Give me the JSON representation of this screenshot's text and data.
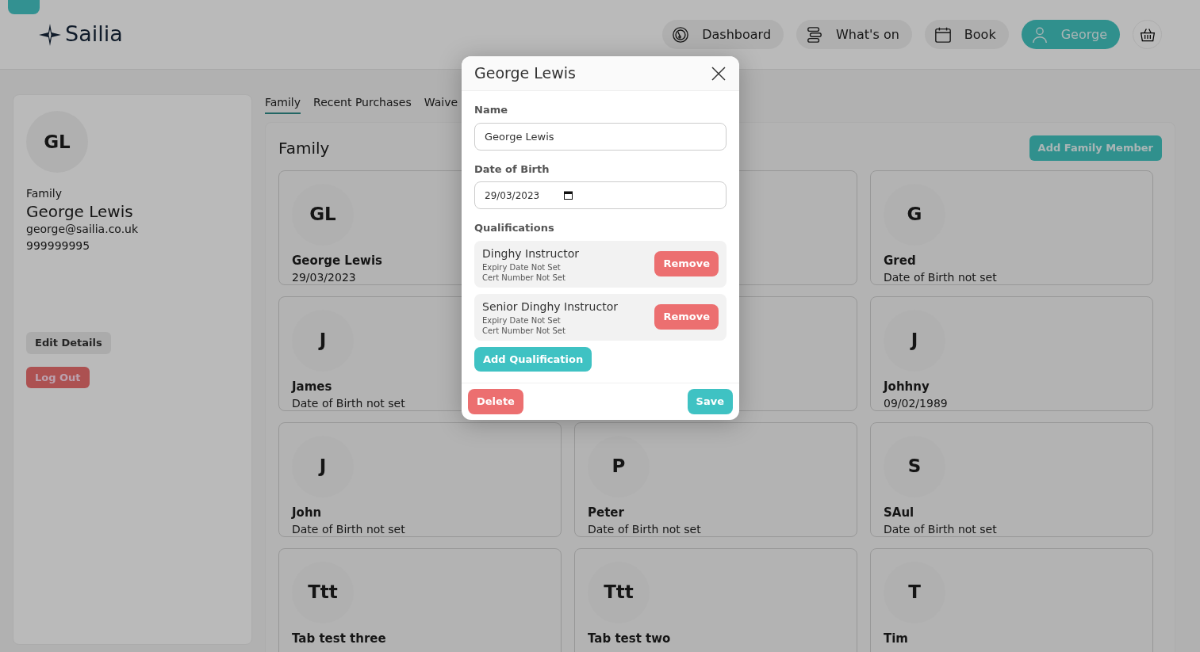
{
  "header": {
    "logo": "Sailia",
    "nav": [
      {
        "label": "Dashboard",
        "selected": false
      },
      {
        "label": "What's on",
        "selected": false
      },
      {
        "label": "Book",
        "selected": false
      },
      {
        "label": "George",
        "selected": true
      }
    ]
  },
  "profile": {
    "initials": "GL",
    "role": "Family",
    "name": "George Lewis",
    "email": "george@sailia.co.uk",
    "phone": "999999995",
    "buttons": [
      {
        "label": "Edit Details",
        "kind": "secondary"
      },
      {
        "label": "Log Out",
        "kind": "danger"
      }
    ]
  },
  "tabs": [
    {
      "label": "Family",
      "selected": true
    },
    {
      "label": "Recent Purchases",
      "selected": false
    },
    {
      "label": "Waive",
      "selected": false
    }
  ],
  "panel": {
    "title": "Family",
    "add_button": "Add Family Member",
    "members": [
      {
        "kind": "member",
        "initials": "GL",
        "name": "George Lewis",
        "dob": "29/03/2023"
      },
      {
        "kind": "covered"
      },
      {
        "kind": "member",
        "initials": "G",
        "name": "Gred",
        "dob": "Date of Birth not set"
      },
      {
        "kind": "member",
        "initials": "J",
        "name": "James",
        "dob": "Date of Birth not set"
      },
      {
        "kind": "covered"
      },
      {
        "kind": "member",
        "initials": "J",
        "name": "Johhny",
        "dob": "09/02/1989"
      },
      {
        "kind": "member",
        "initials": "J",
        "name": "John",
        "dob": "Date of Birth not set"
      },
      {
        "kind": "member",
        "initials": "P",
        "name": "Peter",
        "dob": "Date of Birth not set"
      },
      {
        "kind": "member",
        "initials": "S",
        "name": "SAul",
        "dob": "Date of Birth not set"
      },
      {
        "kind": "member",
        "initials": "Ttt",
        "name": "Tab test three"
      },
      {
        "kind": "member",
        "initials": "Ttt",
        "name": "Tab test two"
      },
      {
        "kind": "member",
        "initials": "T",
        "name": "Tim"
      }
    ]
  },
  "modal": {
    "title": "George Lewis",
    "name_label": "Name",
    "name_value": "George Lewis",
    "dob_label": "Date of Birth",
    "dob_value": "29/03/2023",
    "qual_label": "Qualifications",
    "qualifications": [
      {
        "title": "Dinghy Instructor",
        "expiry": "Expiry Date Not Set",
        "cert": "Cert Number Not Set",
        "button": "Remove"
      },
      {
        "title": "Senior Dinghy Instructor",
        "expiry": "Expiry Date Not Set",
        "cert": "Cert Number Not Set",
        "button": "Remove"
      }
    ],
    "add_button": "Add Qualification",
    "delete_button": "Delete",
    "save_button": "Save"
  }
}
